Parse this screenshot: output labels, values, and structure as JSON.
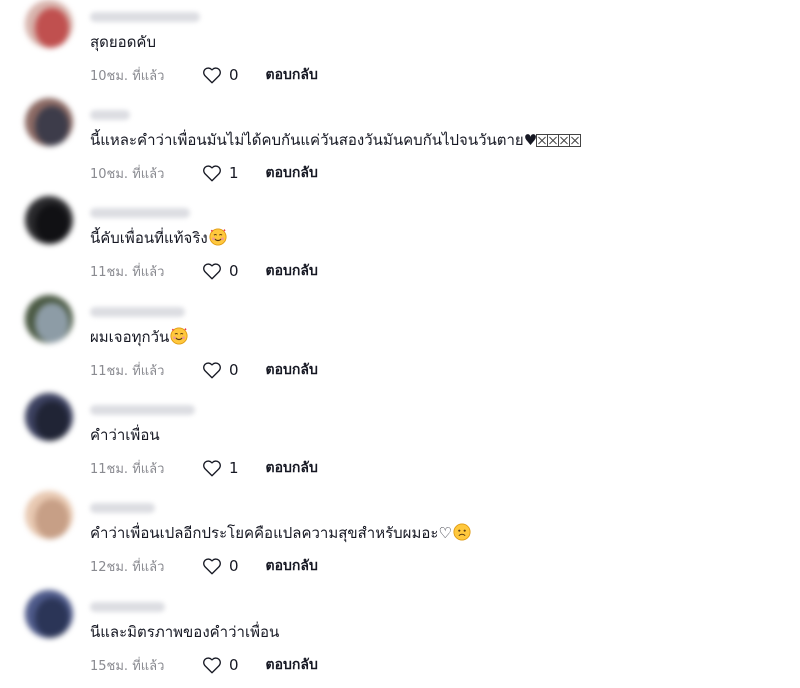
{
  "like_label_icon": "heart-outline-icon",
  "reply_label": "ตอบกลับ",
  "comments": [
    {
      "text": "สุดยอดคับ",
      "time": "10ชม. ที่แล้ว",
      "likes": "0",
      "emoji": null,
      "avatar": [
        "#d8b4ad",
        "#c0504f"
      ],
      "name_width": 110
    },
    {
      "text": "นี้แหละคำว่าเพื่อนมันไม่ได้คบกันแค่วันสองวันมันคบกันไปจนวันตาย♥",
      "time": "10ชม. ที่แล้ว",
      "likes": "1",
      "emoji": "missing-glyph-boxes",
      "avatar": [
        "#8c6a64",
        "#3d3c4a"
      ],
      "name_width": 40
    },
    {
      "text": "นี้คับเพื่อนที่แท้จริง",
      "time": "11ชม. ที่แล้ว",
      "likes": "0",
      "emoji": "smiling-face-with-hearts-emoji",
      "avatar": [
        "#2b2b2e",
        "#111114"
      ],
      "name_width": 100
    },
    {
      "text": "ผมเจอทุกวัน",
      "time": "11ชม. ที่แล้ว",
      "likes": "0",
      "emoji": "smiling-face-with-hearts-emoji",
      "avatar": [
        "#4b5a44",
        "#8d9ca6"
      ],
      "name_width": 95
    },
    {
      "text": "คำว่าเพื่อน",
      "time": "11ชม. ที่แล้ว",
      "likes": "1",
      "emoji": null,
      "avatar": [
        "#3c4160",
        "#202435"
      ],
      "name_width": 105
    },
    {
      "text": "คำว่าเพื่อนเปลอีกประโยคคือแปลความสุขสำหรับผมอะ♡",
      "time": "12ชม. ที่แล้ว",
      "likes": "0",
      "emoji": "sad-face-emoji",
      "avatar": [
        "#e8c9b2",
        "#c79f86"
      ],
      "name_width": 65
    },
    {
      "text": "นีและมิตรภาพของคำว่าเพื่อน",
      "time": "15ชม. ที่แล้ว",
      "likes": "0",
      "emoji": null,
      "avatar": [
        "#4e5a8a",
        "#2b3557"
      ],
      "name_width": 75
    }
  ]
}
